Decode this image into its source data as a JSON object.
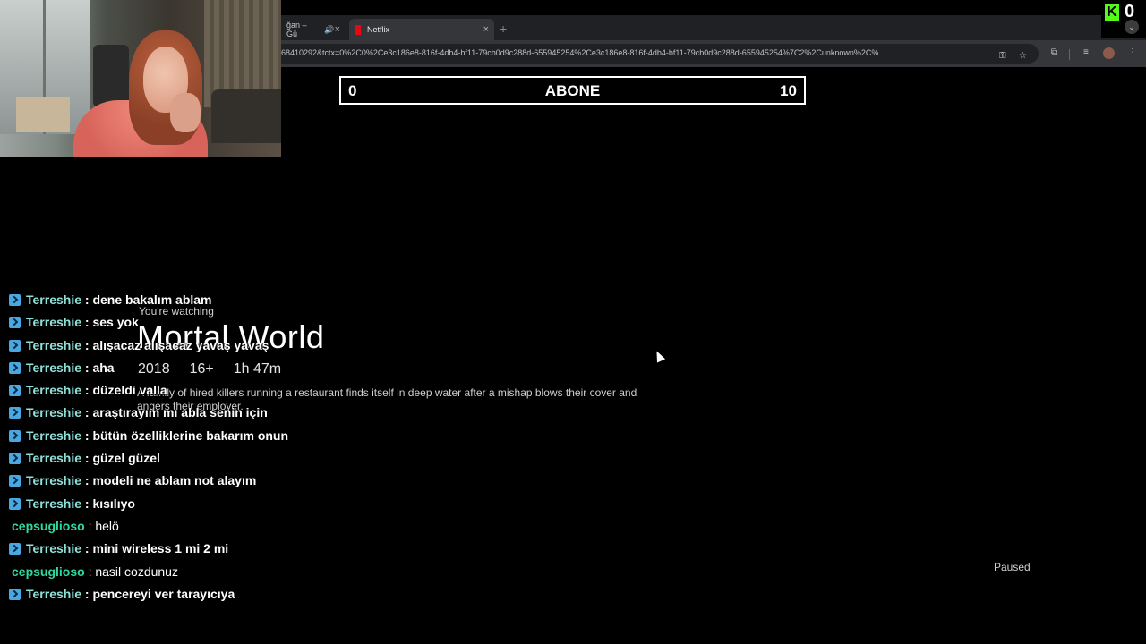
{
  "browser": {
    "tabs": [
      {
        "label": "ğan – Gü",
        "active": false,
        "audio": true
      },
      {
        "label": "Netflix",
        "active": true
      }
    ],
    "new_tab_label": "+",
    "close_glyph": "×",
    "url": "68410292&tctx=0%2C0%2Ce3c186e8-816f-4db4-bf11-79cb0d9c288d-655945254%2Ce3c186e8-816f-4db4-bf11-79cb0d9c288d-655945254%7C2%2Cunknown%2C%"
  },
  "kick": {
    "logo": "K",
    "viewer_count": "0",
    "accent": "#53fc18"
  },
  "goal": {
    "label": "ABONE",
    "min": "0",
    "max": "10",
    "current": 0
  },
  "player": {
    "watching_label": "You're watching",
    "title": "Mortal World",
    "year": "2018",
    "rating": "16+",
    "duration": "1h 47m",
    "synopsis": "A family of hired killers running a restaurant finds itself in deep water after a mishap blows their cover and angers their employer.",
    "status": "Paused"
  },
  "chat": {
    "messages": [
      {
        "user": "Terreshie",
        "text": "dene bakalım ablam",
        "subscriber": true
      },
      {
        "user": "Terreshie",
        "text": "ses yok",
        "subscriber": true
      },
      {
        "user": "Terreshie",
        "text": "alışacaz alışacaz yavaş yavaş",
        "subscriber": true
      },
      {
        "user": "Terreshie",
        "text": "aha",
        "subscriber": true
      },
      {
        "user": "Terreshie",
        "text": "düzeldi valla",
        "subscriber": true
      },
      {
        "user": "Terreshie",
        "text": "araştırayım mı abla senin için",
        "subscriber": true
      },
      {
        "user": "Terreshie",
        "text": "bütün özelliklerine bakarım onun",
        "subscriber": true
      },
      {
        "user": "Terreshie",
        "text": "güzel güzel",
        "subscriber": true
      },
      {
        "user": "Terreshie",
        "text": "modeli ne ablam not alayım",
        "subscriber": true
      },
      {
        "user": "Terreshie",
        "text": "kısılıyo",
        "subscriber": true
      },
      {
        "user": "cepsuglioso",
        "text": "helö",
        "subscriber": false
      },
      {
        "user": "Terreshie",
        "text": "mini wireless 1 mi 2 mi",
        "subscriber": true
      },
      {
        "user": "cepsuglioso",
        "text": "nasil cozdunuz",
        "subscriber": false
      },
      {
        "user": "Terreshie",
        "text": "pencereyi ver tarayıcıya",
        "subscriber": true
      }
    ]
  }
}
